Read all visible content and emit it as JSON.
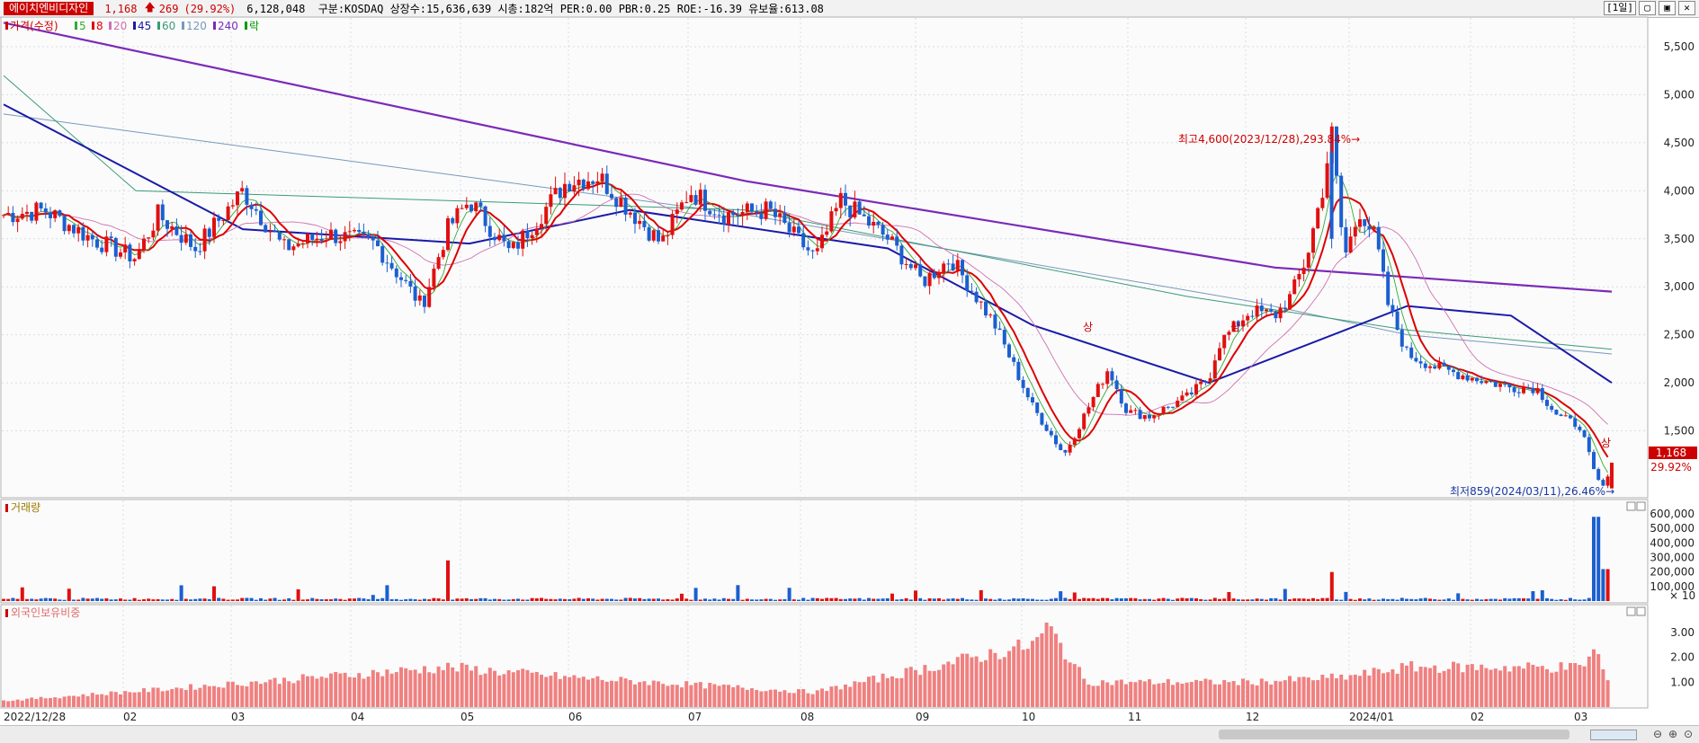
{
  "header": {
    "stock_name": "에이치엔비디자인",
    "price": "1,168",
    "change_arrow": "🡅",
    "change": "269",
    "change_pct": "(29.92%)",
    "info": "6,128,048  구분:KOSDAQ 상장수:15,636,639 시총:182억 PER:0.00 PBR:0.25 ROE:-16.39 유보율:613.08",
    "period_button": "[1일]",
    "buttons": [
      "▢",
      "▣",
      "✕"
    ]
  },
  "price_panel": {
    "legend": [
      {
        "label": "가격(수정)",
        "color": "#cc0000"
      },
      {
        "label": "5",
        "color": "#33aa33"
      },
      {
        "label": "8",
        "color": "#dd0000"
      },
      {
        "label": "20",
        "color": "#d070b0"
      },
      {
        "label": "45",
        "color": "#1a1aa8"
      },
      {
        "label": "60",
        "color": "#3a9a7a"
      },
      {
        "label": "120",
        "color": "#7799bb"
      },
      {
        "label": "240",
        "color": "#7a2ab8"
      },
      {
        "label": "락",
        "color": "#009900"
      }
    ],
    "high_annotation": "최고4,600(2023/12/28),293.84%→",
    "low_annotation": "최저859(2024/03/11),26.46%→",
    "limit_up_marks": [
      "상",
      "상",
      "상"
    ],
    "last_price_tag": "1,168",
    "last_pct_tag": "29.92%",
    "y_ticks": [
      "5,500",
      "5,000",
      "4,500",
      "4,000",
      "3,500",
      "3,000",
      "2,500",
      "2,000",
      "1,500"
    ]
  },
  "volume_panel": {
    "title": "거래량",
    "y_ticks": [
      "600,000",
      "500,000",
      "400,000",
      "300,000",
      "200,000",
      "100,000"
    ],
    "unit": "× 10"
  },
  "foreign_panel": {
    "title": "외국인보유비중",
    "y_ticks": [
      "3.00",
      "2.00",
      "1.00"
    ]
  },
  "x_labels": [
    "2022/12/28",
    "02",
    "03",
    "04",
    "05",
    "06",
    "07",
    "08",
    "09",
    "10",
    "11",
    "12",
    "2024/01",
    "02",
    "03"
  ],
  "chart_data": {
    "type": "candlestick",
    "ylim": [
      859,
      5800
    ],
    "series": [
      {
        "name": "5",
        "color": "#33aa33"
      },
      {
        "name": "8",
        "color": "#dd0000"
      },
      {
        "name": "20",
        "color": "#d070b0"
      },
      {
        "name": "45",
        "color": "#1a1aa8"
      },
      {
        "name": "60",
        "color": "#3a9a7a"
      },
      {
        "name": "120",
        "color": "#7799bb"
      },
      {
        "name": "240",
        "color": "#7a2ab8"
      }
    ],
    "anchors": [
      {
        "date": "2022-12-28",
        "close": 3750
      },
      {
        "date": "2023-01-10",
        "close": 3800
      },
      {
        "date": "2023-01-25",
        "close": 3500
      },
      {
        "date": "2023-02-08",
        "close": 3300
      },
      {
        "date": "2023-02-15",
        "close": 3750
      },
      {
        "date": "2023-02-27",
        "close": 3400
      },
      {
        "date": "2023-03-14",
        "close": 4000
      },
      {
        "date": "2023-03-27",
        "close": 3400
      },
      {
        "date": "2023-04-10",
        "close": 3550
      },
      {
        "date": "2023-04-25",
        "close": 3450
      },
      {
        "date": "2023-05-10",
        "close": 2800
      },
      {
        "date": "2023-05-18",
        "close": 3600
      },
      {
        "date": "2023-05-25",
        "close": 3900
      },
      {
        "date": "2023-06-07",
        "close": 3350
      },
      {
        "date": "2023-06-25",
        "close": 4100
      },
      {
        "date": "2023-07-05",
        "close": 4150
      },
      {
        "date": "2023-07-15",
        "close": 3800
      },
      {
        "date": "2023-07-25",
        "close": 3450
      },
      {
        "date": "2023-08-03",
        "close": 4000
      },
      {
        "date": "2023-08-14",
        "close": 3750
      },
      {
        "date": "2023-08-28",
        "close": 3800
      },
      {
        "date": "2023-09-12",
        "close": 3300
      },
      {
        "date": "2023-09-20",
        "close": 3900
      },
      {
        "date": "2023-10-05",
        "close": 3500
      },
      {
        "date": "2023-10-16",
        "close": 3050
      },
      {
        "date": "2023-10-25",
        "close": 3300
      },
      {
        "date": "2023-11-08",
        "close": 2600
      },
      {
        "date": "2023-11-20",
        "close": 1750
      },
      {
        "date": "2023-11-30",
        "close": 1250
      },
      {
        "date": "2023-12-07",
        "close": 1700
      },
      {
        "date": "2023-12-14",
        "close": 2150
      },
      {
        "date": "2023-12-20",
        "close": 1700
      },
      {
        "date": "2023-12-27",
        "close": 1650
      },
      {
        "date": "2024-01-08",
        "close": 1850
      },
      {
        "date": "2024-01-15",
        "close": 2050
      },
      {
        "date": "2024-01-18",
        "close": 2400
      },
      {
        "date": "2024-01-28",
        "close": 2750
      },
      {
        "date": "2024-02-05",
        "close": 2700
      },
      {
        "date": "2024-02-10",
        "close": 2900
      },
      {
        "date": "2024-02-15",
        "close": 3300
      },
      {
        "date": "2024-02-20",
        "close": 4000
      },
      {
        "date": "2024-02-23",
        "close": 4600
      },
      {
        "date": "2024-02-27",
        "close": 3300
      },
      {
        "date": "2024-03-03",
        "close": 3800
      },
      {
        "date": "2024-03-08",
        "close": 3500
      },
      {
        "date": "2024-03-12",
        "close": 2800
      },
      {
        "date": "2024-03-18",
        "close": 2300
      },
      {
        "date": "2024-03-28",
        "close": 2150
      },
      {
        "date": "2024-04-08",
        "close": 2050
      },
      {
        "date": "2024-04-20",
        "close": 1950
      },
      {
        "date": "2024-04-28",
        "close": 1950
      },
      {
        "date": "2024-05-05",
        "close": 1650
      },
      {
        "date": "2024-05-12",
        "close": 1550
      },
      {
        "date": "2024-05-17",
        "close": 1000
      },
      {
        "date": "2024-05-20",
        "close": 900
      },
      {
        "date": "2024-05-22",
        "close": 1168
      }
    ],
    "moving_averages": {
      "ma240": [
        {
          "date": "2022-12-28",
          "value": 5750
        },
        {
          "date": "2023-08-21",
          "value": 4100
        },
        {
          "date": "2024-02-05",
          "value": 3200
        },
        {
          "date": "2024-05-22",
          "value": 2950
        }
      ],
      "ma120": [
        {
          "date": "2022-12-28",
          "value": 4800
        },
        {
          "date": "2023-08-21",
          "value": 3750
        },
        {
          "date": "2024-01-28",
          "value": 2850
        },
        {
          "date": "2024-03-18",
          "value": 2500
        },
        {
          "date": "2024-05-22",
          "value": 2300
        }
      ],
      "ma60": [
        {
          "date": "2022-12-28",
          "value": 5200
        },
        {
          "date": "2023-02-08",
          "value": 4000
        },
        {
          "date": "2023-08-21",
          "value": 3800
        },
        {
          "date": "2024-01-08",
          "value": 2900
        },
        {
          "date": "2024-03-18",
          "value": 2550
        },
        {
          "date": "2024-05-22",
          "value": 2350
        }
      ],
      "ma45": [
        {
          "date": "2022-12-28",
          "value": 4900
        },
        {
          "date": "2023-03-14",
          "value": 3600
        },
        {
          "date": "2023-05-25",
          "value": 3450
        },
        {
          "date": "2023-07-15",
          "value": 3800
        },
        {
          "date": "2023-10-05",
          "value": 3400
        },
        {
          "date": "2023-11-20",
          "value": 2600
        },
        {
          "date": "2024-01-15",
          "value": 2000
        },
        {
          "date": "2024-03-18",
          "value": 2800
        },
        {
          "date": "2024-04-20",
          "value": 2700
        },
        {
          "date": "2024-05-22",
          "value": 2000
        }
      ]
    },
    "volume": {
      "ylim": [
        0,
        600000
      ],
      "spikes": [
        {
          "date": "2024-05-17",
          "value": 580000
        },
        {
          "date": "2024-05-22",
          "value": 610000
        },
        {
          "date": "2024-05-20",
          "value": 220000
        },
        {
          "date": "2024-02-23",
          "value": 200000
        },
        {
          "date": "2023-05-18",
          "value": 280000
        }
      ]
    },
    "foreign_ratio": {
      "ylim": [
        0,
        3.5
      ],
      "anchors": [
        {
          "date": "2022-12-28",
          "value": 0.25
        },
        {
          "date": "2023-02-15",
          "value": 0.7
        },
        {
          "date": "2023-05-18",
          "value": 1.6
        },
        {
          "date": "2023-06-25",
          "value": 1.2
        },
        {
          "date": "2023-09-12",
          "value": 0.6
        },
        {
          "date": "2023-11-20",
          "value": 2.5
        },
        {
          "date": "2023-11-25",
          "value": 3.2
        },
        {
          "date": "2023-12-07",
          "value": 1.0
        },
        {
          "date": "2024-01-28",
          "value": 1.0
        },
        {
          "date": "2024-02-27",
          "value": 1.2
        },
        {
          "date": "2024-03-18",
          "value": 1.6
        },
        {
          "date": "2024-05-12",
          "value": 1.6
        },
        {
          "date": "2024-05-17",
          "value": 2.3
        },
        {
          "date": "2024-05-22",
          "value": 0.6
        }
      ]
    }
  }
}
